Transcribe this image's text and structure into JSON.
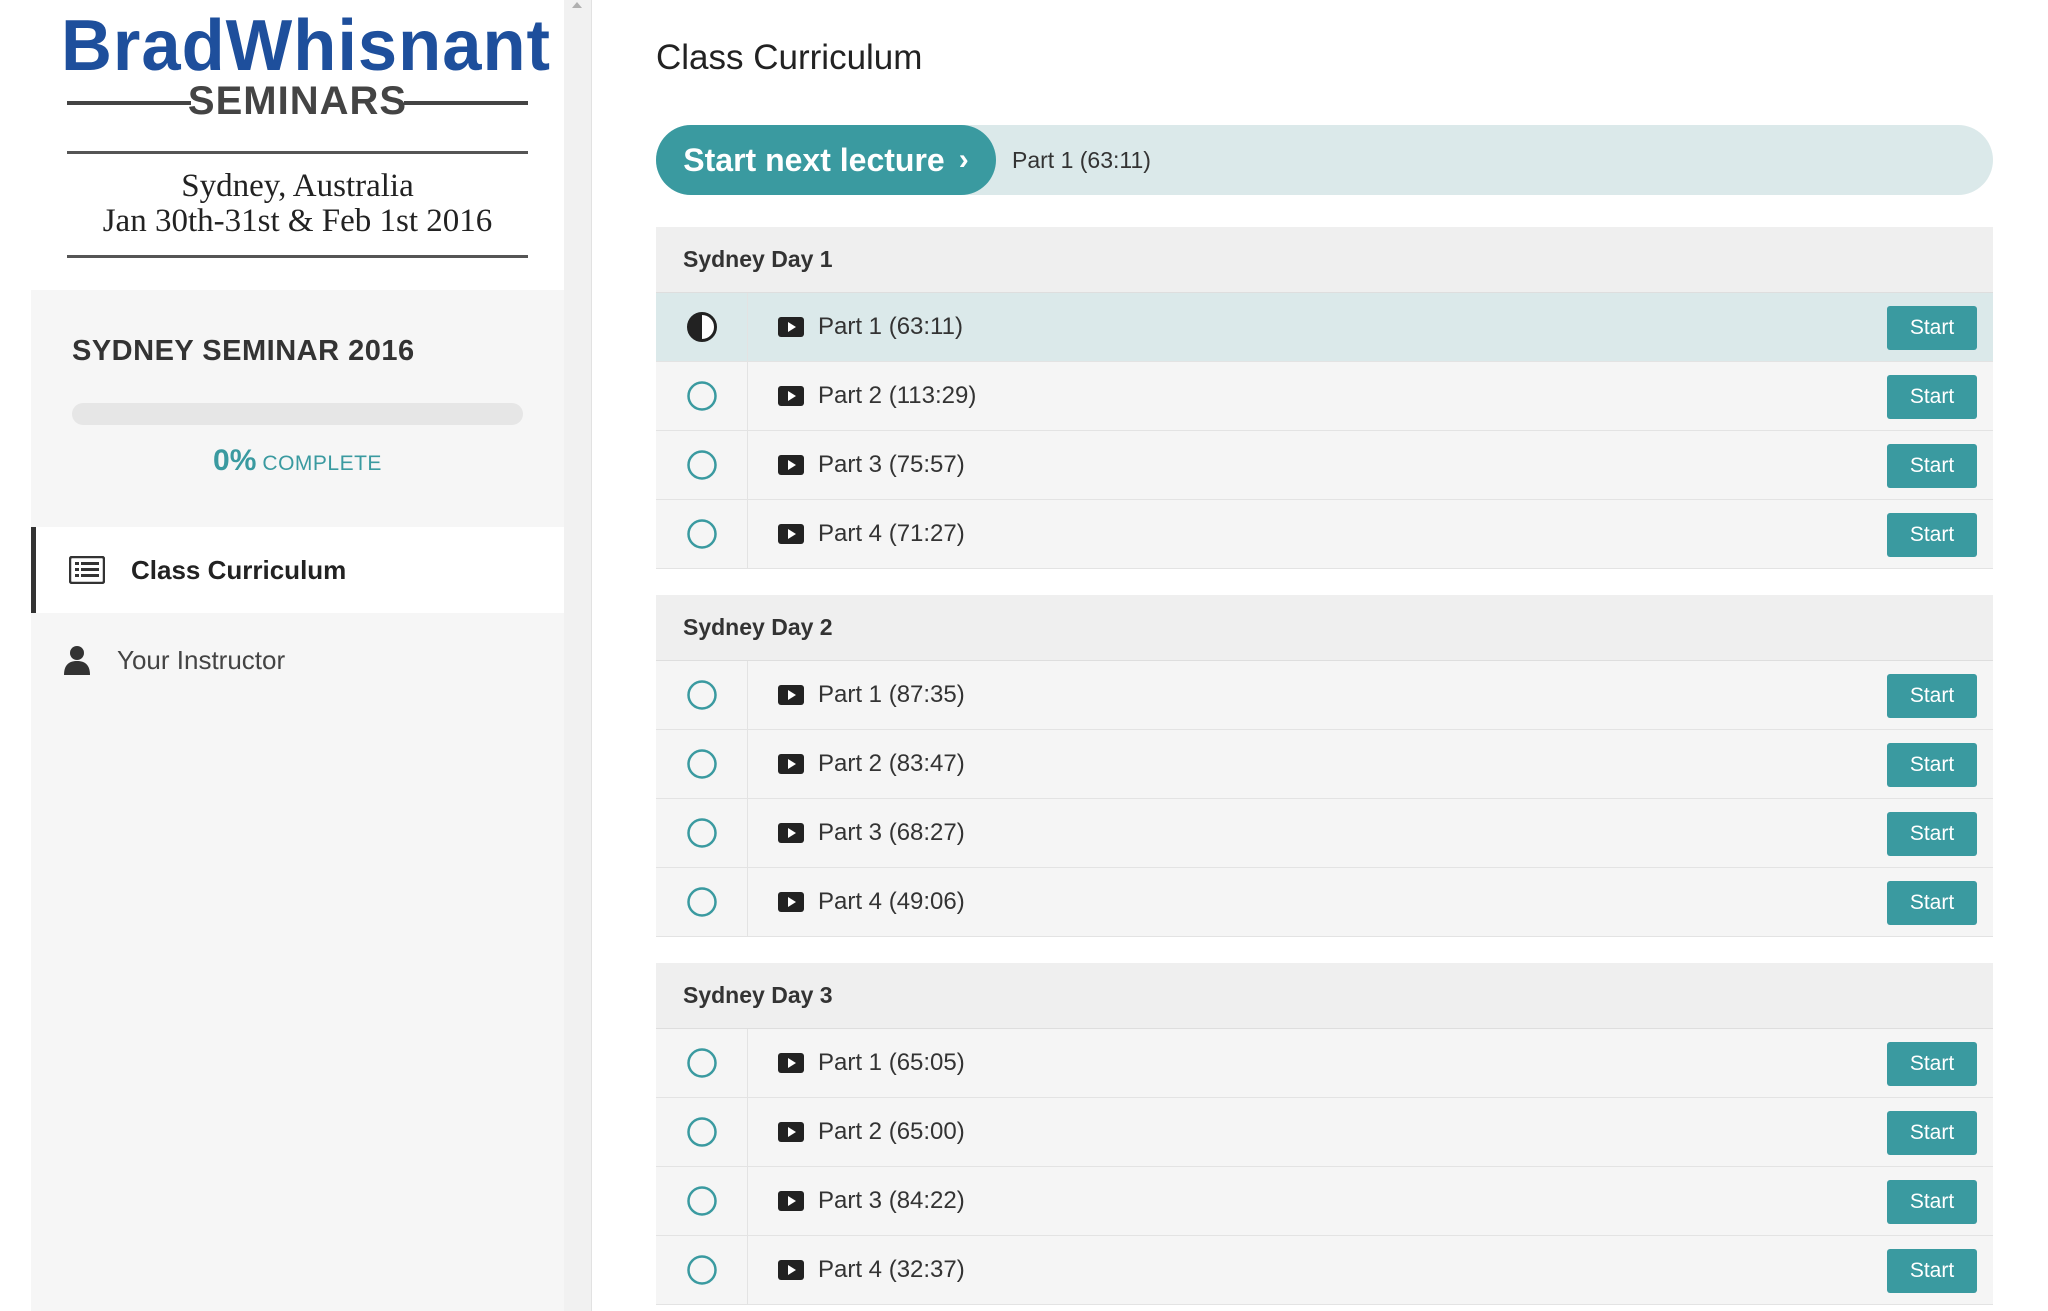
{
  "sidebar": {
    "logo": {
      "brand_part1": "Brad",
      "brand_part2": "Whisnant",
      "subtitle": "SEMINARS",
      "location": "Sydney, Australia",
      "dates": "Jan 30th-31st & Feb 1st 2016"
    },
    "course_title": "SYDNEY SEMINAR 2016",
    "progress": {
      "percent_value": 0,
      "percent_label": "0%",
      "complete_label": "COMPLETE"
    },
    "nav": [
      {
        "label": "Class Curriculum",
        "icon": "list-icon",
        "active": true
      },
      {
        "label": "Your Instructor",
        "icon": "user-icon",
        "active": false
      }
    ]
  },
  "main": {
    "title": "Class Curriculum",
    "next_lecture": {
      "button_label": "Start next lecture",
      "chevron": "›",
      "lecture_label": "Part 1 (63:11)"
    },
    "sections": [
      {
        "title": "Sydney Day 1",
        "lectures": [
          {
            "title": "Part 1 (63:11)",
            "status": "in-progress",
            "button": "Start"
          },
          {
            "title": "Part 2 (113:29)",
            "status": "not-started",
            "button": "Start"
          },
          {
            "title": "Part 3 (75:57)",
            "status": "not-started",
            "button": "Start"
          },
          {
            "title": "Part 4 (71:27)",
            "status": "not-started",
            "button": "Start"
          }
        ]
      },
      {
        "title": "Sydney Day 2",
        "lectures": [
          {
            "title": "Part 1 (87:35)",
            "status": "not-started",
            "button": "Start"
          },
          {
            "title": "Part 2 (83:47)",
            "status": "not-started",
            "button": "Start"
          },
          {
            "title": "Part 3 (68:27)",
            "status": "not-started",
            "button": "Start"
          },
          {
            "title": "Part 4 (49:06)",
            "status": "not-started",
            "button": "Start"
          }
        ]
      },
      {
        "title": "Sydney Day 3",
        "lectures": [
          {
            "title": "Part 1 (65:05)",
            "status": "not-started",
            "button": "Start"
          },
          {
            "title": "Part 2 (65:00)",
            "status": "not-started",
            "button": "Start"
          },
          {
            "title": "Part 3 (84:22)",
            "status": "not-started",
            "button": "Start"
          },
          {
            "title": "Part 4 (32:37)",
            "status": "not-started",
            "button": "Start"
          }
        ]
      }
    ]
  },
  "colors": {
    "accent": "#3a9aa0",
    "brand_blue": "#1e4f9c",
    "highlight_row": "#dbe9ea"
  }
}
